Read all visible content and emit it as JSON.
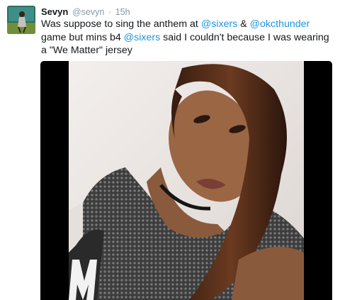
{
  "tweet": {
    "display_name": "Sevyn",
    "handle": "@sevyn",
    "separator": "·",
    "timestamp": "15h",
    "text_parts": {
      "p1": "Was suppose to sing the anthem at ",
      "m1": "@sixers",
      "p2": " & ",
      "m2": "@okcthunder",
      "p3": " game but mins b4 ",
      "m3": "@sixers",
      "p4": " said I couldn't because I was wearing a \"We Matter\" jersey"
    }
  },
  "colors": {
    "link": "#1b95e0",
    "meta": "#8899a6",
    "text": "#14171a",
    "media_bg": "#000000"
  },
  "icons": {
    "avatar": "profile-photo",
    "media": "video-selfie"
  }
}
